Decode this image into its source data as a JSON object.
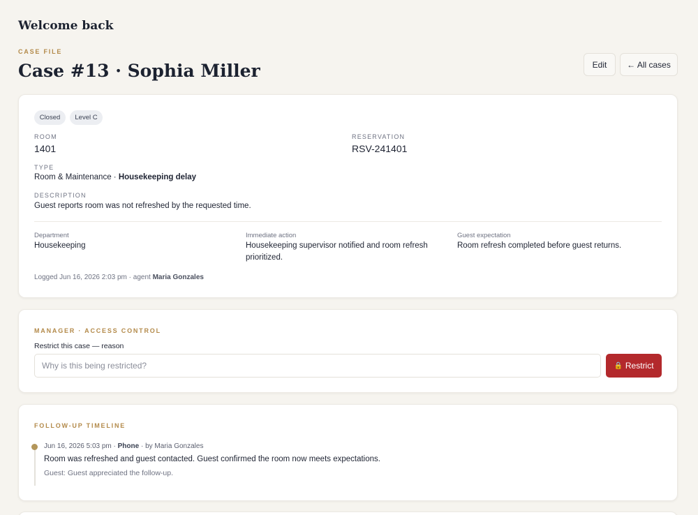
{
  "header": {
    "welcome": "Welcome back",
    "eyebrow": "CASE FILE",
    "title": "Case #13 · Sophia Miller",
    "edit_label": "Edit",
    "all_cases_label": "← All cases"
  },
  "case": {
    "badges": [
      "Closed",
      "Level C"
    ],
    "room_label": "ROOM",
    "room": "1401",
    "reservation_label": "RESERVATION",
    "reservation": "RSV-241401",
    "type_label": "TYPE",
    "type_category": "Room & Maintenance · ",
    "type_detail": "Housekeeping delay",
    "description_label": "DESCRIPTION",
    "description": "Guest reports room was not refreshed by the requested time.",
    "department_label": "Department",
    "department": "Housekeeping",
    "action_label": "Immediate action",
    "action": "Housekeeping supervisor notified and room refresh prioritized.",
    "expectation_label": "Guest expectation",
    "expectation": "Room refresh completed before guest returns.",
    "logged_prefix": "Logged Jun 16, 2026 2:03 pm · agent ",
    "logged_agent": "Maria Gonzales"
  },
  "access": {
    "eyebrow": "MANAGER · ACCESS CONTROL",
    "label": "Restrict this case — reason",
    "placeholder": "Why is this being restricted?",
    "button_label": "Restrict",
    "button_icon": "lock-icon"
  },
  "timeline": {
    "eyebrow": "FOLLOW-UP TIMELINE",
    "entries": [
      {
        "timestamp": "Jun 16, 2026 5:03 pm · ",
        "channel": "Phone",
        "by": " · by Maria Gonzales",
        "text": "Room was refreshed and guest contacted. Guest confirmed the room now meets expectations.",
        "guest_note": "Guest: Guest appreciated the follow-up."
      }
    ]
  },
  "colors": {
    "background": "#f6f4ef",
    "accent_gold": "#b38a4a",
    "restrict_red": "#b3292c"
  }
}
